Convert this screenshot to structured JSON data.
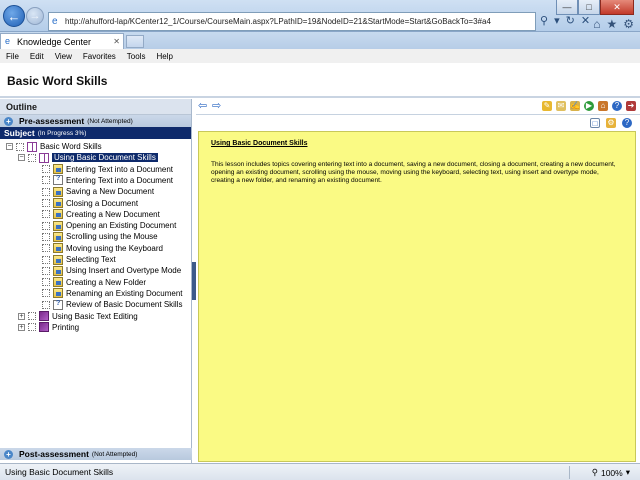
{
  "browser": {
    "url": "http://ahufford-lap/KCenter12_1/Course/CourseMain.aspx?LPathID=19&NodeID=21&StartMode=Start&GoBackTo=3#a4",
    "tab_title": "Knowledge Center",
    "menu": [
      "File",
      "Edit",
      "View",
      "Favorites",
      "Tools",
      "Help"
    ]
  },
  "page": {
    "title": "Basic Word Skills"
  },
  "outline": {
    "header": "Outline",
    "pre_assessment": {
      "title": "Pre-assessment",
      "status": "(Not Attempted)"
    },
    "subject": {
      "title": "Subject",
      "status": "(In Progress 3%)"
    },
    "tree": [
      {
        "label": "Basic Word Skills",
        "level": 0,
        "icon": "book-open-icon",
        "expander": "minus"
      },
      {
        "label": "Using Basic Document Skills",
        "level": 1,
        "icon": "book-open-icon",
        "expander": "minus",
        "selected": true
      },
      {
        "label": "Entering Text into a Document",
        "level": 2,
        "icon": "topic-icon"
      },
      {
        "label": "Entering Text into a Document",
        "level": 2,
        "icon": "review-icon"
      },
      {
        "label": "Saving a New Document",
        "level": 2,
        "icon": "topic-icon"
      },
      {
        "label": "Closing a Document",
        "level": 2,
        "icon": "topic-icon"
      },
      {
        "label": "Creating a New Document",
        "level": 2,
        "icon": "topic-icon"
      },
      {
        "label": "Opening an Existing Document",
        "level": 2,
        "icon": "topic-icon"
      },
      {
        "label": "Scrolling using the Mouse",
        "level": 2,
        "icon": "topic-icon"
      },
      {
        "label": "Moving using the Keyboard",
        "level": 2,
        "icon": "topic-icon"
      },
      {
        "label": "Selecting Text",
        "level": 2,
        "icon": "topic-icon"
      },
      {
        "label": "Using Insert and Overtype Mode",
        "level": 2,
        "icon": "topic-icon"
      },
      {
        "label": "Creating a New Folder",
        "level": 2,
        "icon": "topic-icon"
      },
      {
        "label": "Renaming an Existing Document",
        "level": 2,
        "icon": "topic-icon"
      },
      {
        "label": "Review of Basic Document Skills",
        "level": 2,
        "icon": "review-icon"
      },
      {
        "label": "Using Basic Text Editing",
        "level": 1,
        "icon": "book-icon",
        "expander": "plus"
      },
      {
        "label": "Printing",
        "level": 1,
        "icon": "book-icon",
        "expander": "plus"
      }
    ],
    "post_assessment": {
      "title": "Post-assessment",
      "status": "(Not Attempted)"
    }
  },
  "content": {
    "lesson_title": "Using Basic Document Skills",
    "lesson_body": "This lesson includes topics covering entering text into a document, saving a new document, closing a document, creating a new document, opening an existing document, scrolling using the mouse, moving using the keyboard, selecting text, using insert and overtype mode, creating a new folder, and renaming an existing document."
  },
  "statusbar": {
    "text": "Using Basic Document Skills",
    "zoom": "100%"
  },
  "colors": {
    "content_bg": "#fafa84",
    "subject_bar": "#0e2a6b",
    "accent": "#2d68c4"
  }
}
